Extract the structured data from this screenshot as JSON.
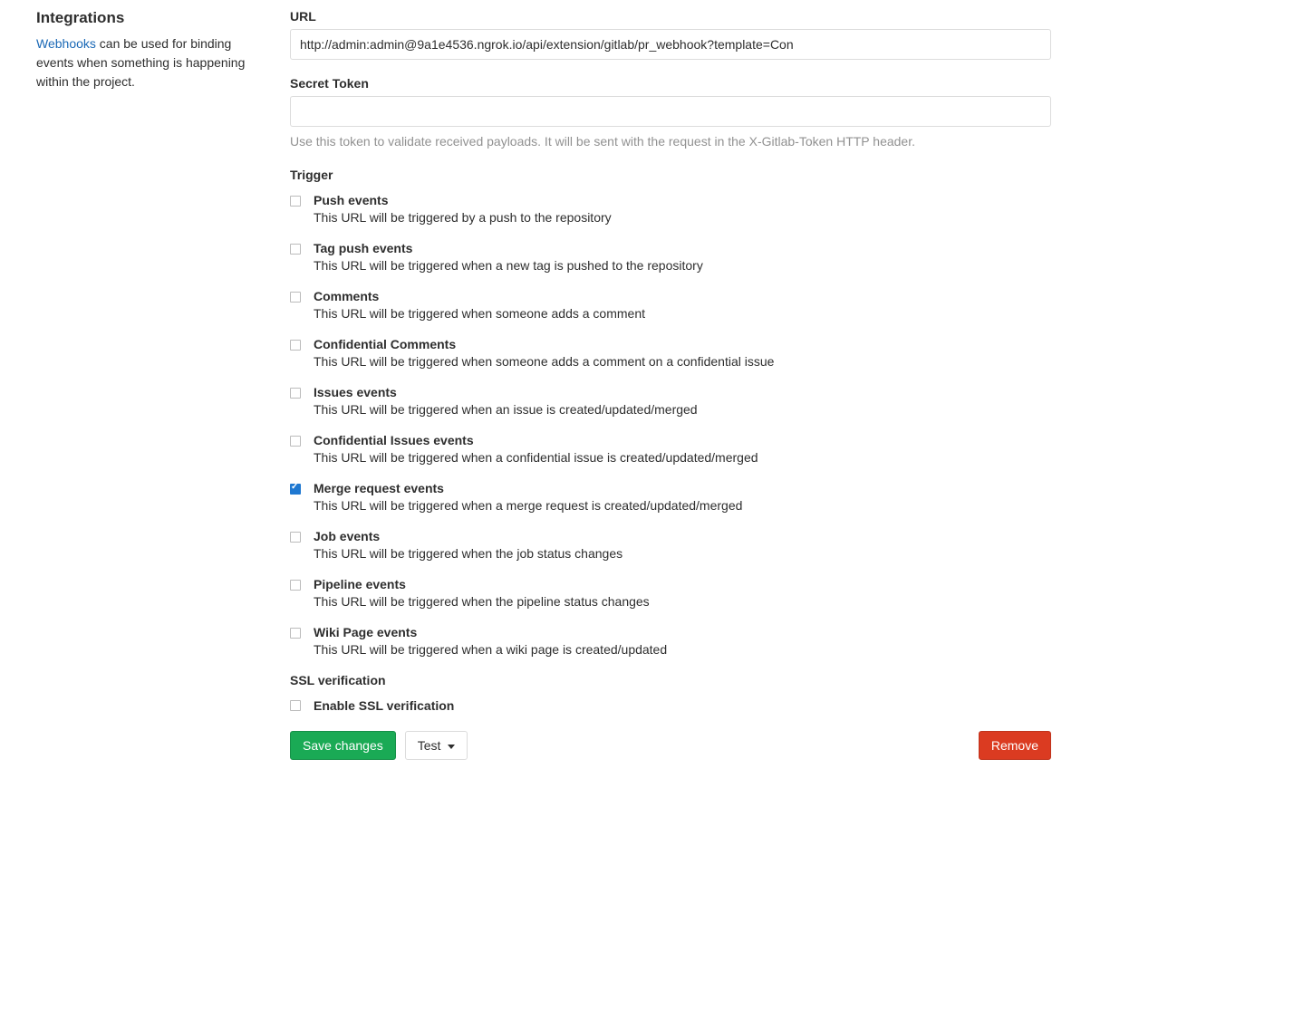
{
  "sidebar": {
    "title": "Integrations",
    "link_text": "Webhooks",
    "description_rest": " can be used for binding events when something is happening within the project."
  },
  "form": {
    "url_label": "URL",
    "url_value": "http://admin:admin@9a1e4536.ngrok.io/api/extension/gitlab/pr_webhook?template=Con",
    "secret_label": "Secret Token",
    "secret_value": "",
    "secret_help": "Use this token to validate received payloads. It will be sent with the request in the X-Gitlab-Token HTTP header.",
    "trigger_label": "Trigger",
    "ssl_label": "SSL verification",
    "ssl_enable_label": "Enable SSL verification",
    "ssl_checked": false
  },
  "triggers": [
    {
      "title": "Push events",
      "desc": "This URL will be triggered by a push to the repository",
      "checked": false
    },
    {
      "title": "Tag push events",
      "desc": "This URL will be triggered when a new tag is pushed to the repository",
      "checked": false
    },
    {
      "title": "Comments",
      "desc": "This URL will be triggered when someone adds a comment",
      "checked": false
    },
    {
      "title": "Confidential Comments",
      "desc": "This URL will be triggered when someone adds a comment on a confidential issue",
      "checked": false
    },
    {
      "title": "Issues events",
      "desc": "This URL will be triggered when an issue is created/updated/merged",
      "checked": false
    },
    {
      "title": "Confidential Issues events",
      "desc": "This URL will be triggered when a confidential issue is created/updated/merged",
      "checked": false
    },
    {
      "title": "Merge request events",
      "desc": "This URL will be triggered when a merge request is created/updated/merged",
      "checked": true
    },
    {
      "title": "Job events",
      "desc": "This URL will be triggered when the job status changes",
      "checked": false
    },
    {
      "title": "Pipeline events",
      "desc": "This URL will be triggered when the pipeline status changes",
      "checked": false
    },
    {
      "title": "Wiki Page events",
      "desc": "This URL will be triggered when a wiki page is created/updated",
      "checked": false
    }
  ],
  "buttons": {
    "save": "Save changes",
    "test": "Test",
    "remove": "Remove"
  }
}
